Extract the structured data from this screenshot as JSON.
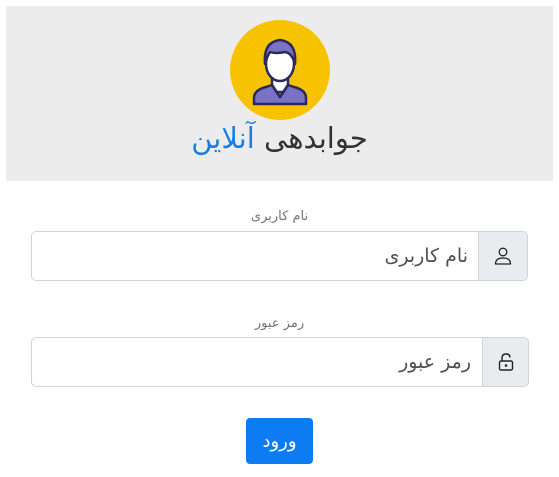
{
  "header": {
    "avatar_icon": "user-avatar-icon",
    "title_main": "جوابدهی",
    "title_accent": "آنلاین",
    "avatar_bg": "#f7c200",
    "accent_color": "#1a7fe0"
  },
  "login_form": {
    "username": {
      "label": "نام کاربری",
      "placeholder": "نام کاربری",
      "value": "",
      "icon": "person-icon"
    },
    "password": {
      "label": "رمز عبور",
      "placeholder": "رمز عبور",
      "value": "",
      "icon": "lock-icon"
    },
    "submit_label": "ورود",
    "submit_color": "#0d7bf2"
  }
}
